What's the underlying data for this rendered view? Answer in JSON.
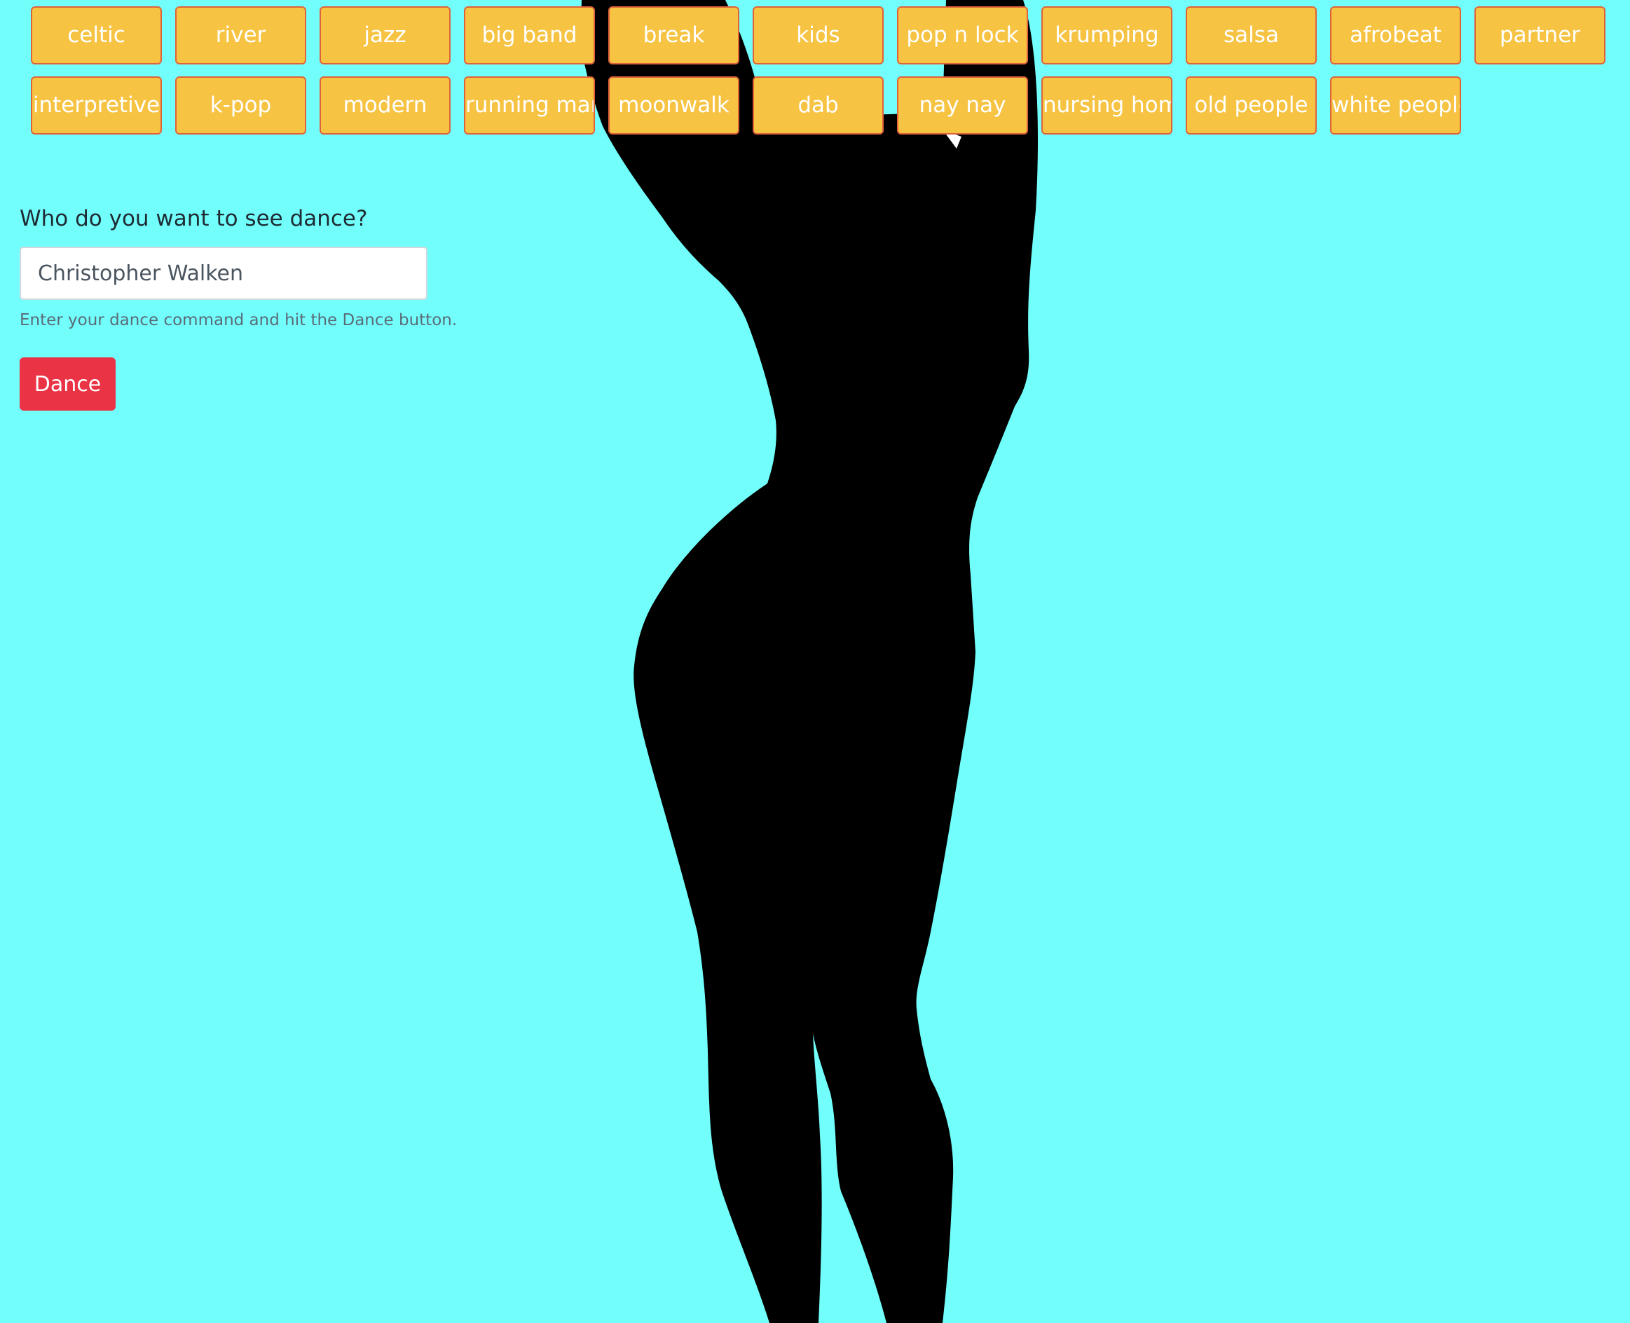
{
  "dance_styles": {
    "row1": [
      "celtic",
      "river",
      "jazz",
      "big band",
      "break",
      "kids",
      "pop n lock",
      "krumping",
      "salsa",
      "afrobeat",
      "partner"
    ],
    "row2": [
      "interpretive",
      "k-pop",
      "modern",
      "running man",
      "moonwalk",
      "dab",
      "nay nay",
      "nursing home",
      "old people",
      "white people"
    ]
  },
  "form": {
    "question": "Who do you want to see dance?",
    "input_value": "Christopher Walken",
    "help_text": "Enter your dance command and hit the Dance button.",
    "submit_label": "Dance"
  },
  "colors": {
    "background": "#72fffc",
    "chip_fill": "#f6c343",
    "chip_border": "#e0623a",
    "button_red": "#ea3345",
    "silhouette": "#000000"
  },
  "icons": {
    "background_figure": "dancer-silhouette"
  }
}
